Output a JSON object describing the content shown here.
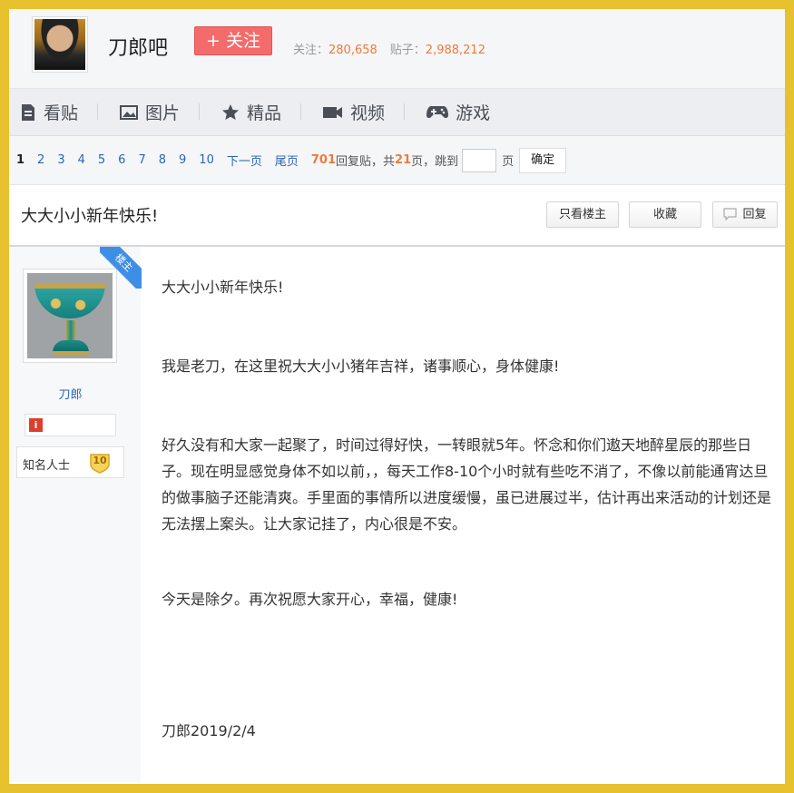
{
  "forum": {
    "name": "刀郎吧",
    "follow_label": "+ 关注",
    "followers_label": "关注：",
    "followers": "280,658",
    "posts_label": "贴子：",
    "posts": "2,988,212"
  },
  "nav": [
    {
      "label": "看贴",
      "icon": "document-icon"
    },
    {
      "label": "图片",
      "icon": "image-icon"
    },
    {
      "label": "精品",
      "icon": "star-icon"
    },
    {
      "label": "视频",
      "icon": "video-icon"
    },
    {
      "label": "游戏",
      "icon": "gamepad-icon"
    }
  ],
  "pager": {
    "current": "1",
    "pages": [
      "2",
      "3",
      "4",
      "5",
      "6",
      "7",
      "8",
      "9",
      "10"
    ],
    "next": "下一页",
    "last": "尾页",
    "reply_count": "701",
    "reply_text": "回复贴，共",
    "page_count": "21",
    "page_text": "页，跳到",
    "page_suffix": "页",
    "confirm": "确定",
    "jump_value": ""
  },
  "thread": {
    "title": "大大小小新年快乐!",
    "only_owner": "只看楼主",
    "favorite": "收藏",
    "reply": "回复"
  },
  "author": {
    "badge": "楼主",
    "name": "刀郎",
    "title": "知名人士",
    "level": "10"
  },
  "post": {
    "p1": "大大小小新年快乐!",
    "p2": "我是老刀，在这里祝大大小小猪年吉祥，诸事顺心，身体健康!",
    "p3": "好久没有和大家一起聚了，时间过得好快，一转眼就5年。怀念和你们遨天地醉星辰的那些日子。现在明显感觉身体不如以前，，每天工作8-10个小时就有些吃不消了，不像以前能通宵达旦的做事脑子还能清爽。手里面的事情所以进度缓慢，虽已进展过半，估计再出来活动的计划还是无法摆上案头。让大家记挂了，内心很是不安。",
    "p4": "今天是除夕。再次祝愿大家开心，幸福，健康!",
    "signature": "刀郎2019/2/4"
  },
  "colors": {
    "frame": "#e8c12e",
    "follow_button": "#f46b6b",
    "link": "#2d64b3",
    "highlight": "#f07a3c",
    "owner_ribbon": "#3f8ee6"
  }
}
